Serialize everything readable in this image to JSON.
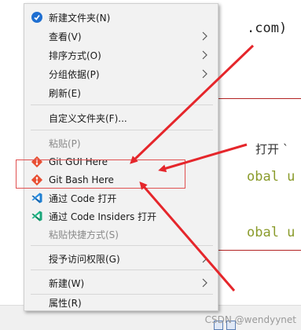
{
  "background": {
    "code_top": ".com)",
    "open_text": "打开 `",
    "code_line1": "obal u",
    "code_line2": "obal u",
    "watermark": "CSDN @wendyynet"
  },
  "menu": {
    "items": [
      {
        "label": "新建文件夹(N)",
        "icon": "new-folder-icon",
        "disabled": false,
        "submenu": false
      },
      {
        "label": "查看(V)",
        "icon": "",
        "disabled": false,
        "submenu": true
      },
      {
        "label": "排序方式(O)",
        "icon": "",
        "disabled": false,
        "submenu": true
      },
      {
        "label": "分组依据(P)",
        "icon": "",
        "disabled": false,
        "submenu": true
      },
      {
        "label": "刷新(E)",
        "icon": "",
        "disabled": false,
        "submenu": false
      },
      {
        "label": "自定义文件夹(F)...",
        "icon": "",
        "disabled": false,
        "submenu": false
      },
      {
        "label": "粘贴(P)",
        "icon": "",
        "disabled": true,
        "submenu": false
      },
      {
        "label": "Git GUI Here",
        "icon": "git-gui-icon",
        "disabled": false,
        "submenu": false
      },
      {
        "label": "Git Bash Here",
        "icon": "git-bash-icon",
        "disabled": false,
        "submenu": false
      },
      {
        "label": "通过 Code 打开",
        "icon": "vscode-icon",
        "disabled": false,
        "submenu": false
      },
      {
        "label": "通过 Code Insiders 打开",
        "icon": "vscode-insiders-icon",
        "disabled": false,
        "submenu": false
      },
      {
        "label": "粘贴快捷方式(S)",
        "icon": "",
        "disabled": true,
        "submenu": false
      },
      {
        "label": "授予访问权限(G)",
        "icon": "",
        "disabled": false,
        "submenu": true
      },
      {
        "label": "新建(W)",
        "icon": "",
        "disabled": false,
        "submenu": true
      },
      {
        "label": "属性(R)",
        "icon": "",
        "disabled": false,
        "submenu": false
      }
    ]
  },
  "colors": {
    "arrow": "#e5262b",
    "code_green": "#8a9b2b",
    "code_purple": "#8e3a8e",
    "git": "#e84e31",
    "vscode": "#1f7fd1",
    "vscode_insiders": "#1aa67a"
  }
}
